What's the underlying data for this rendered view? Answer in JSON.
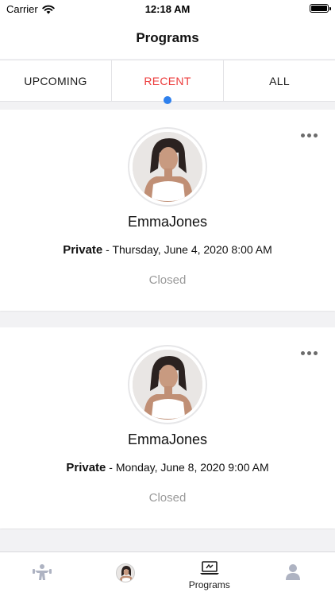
{
  "status_bar": {
    "carrier": "Carrier",
    "time": "12:18 AM"
  },
  "nav": {
    "title": "Programs"
  },
  "tabs": [
    {
      "label": "UPCOMING",
      "active": false
    },
    {
      "label": "RECENT",
      "active": true
    },
    {
      "label": "ALL",
      "active": false
    }
  ],
  "programs": [
    {
      "name": "EmmaJones",
      "type": "Private",
      "separator": "-",
      "datetime": "Thursday, June 4, 2020 8:00 AM",
      "status": "Closed"
    },
    {
      "name": "EmmaJones",
      "type": "Private",
      "separator": "-",
      "datetime": "Monday, June 8, 2020 9:00 AM",
      "status": "Closed"
    }
  ],
  "tab_bar": {
    "items": [
      {
        "icon": "fitness-icon",
        "label": ""
      },
      {
        "icon": "profile-avatar",
        "label": ""
      },
      {
        "icon": "programs-laptop-icon",
        "label": "Programs"
      },
      {
        "icon": "user-icon",
        "label": ""
      }
    ]
  },
  "colors": {
    "active_tab": "#ec3b3b",
    "indicator_dot": "#2f80ed",
    "status_text": "#9a9a9a"
  }
}
